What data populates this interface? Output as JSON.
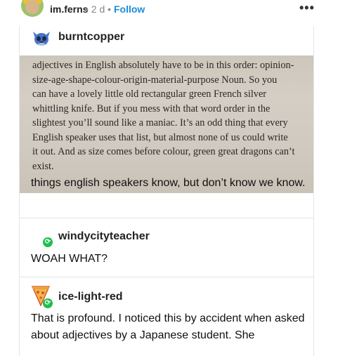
{
  "header": {
    "author": "im.ferns",
    "meta": "• 2 d •",
    "follow_label": "Follow",
    "more_label": "•••"
  },
  "trail": [
    {
      "username": "burntcopper",
      "book_lines": [
        "adjectives in English absolutely have to be in this order: opinion-",
        "size-age-shape-colour-origin-material-purpose Noun. So you",
        "can have a lovely little old rectangular green French silver",
        "whittling knife. But if you mess with that word order in the",
        "slightest you’ll sound like a maniac. It’s an odd thing that every",
        "English speaker uses that list, but almost none of us could write",
        "it out. And as size comes before colour, green great dragons can’t",
        "exist."
      ],
      "body": "things english speakers know, but don’t know we know."
    },
    {
      "username": "windycityteacher",
      "body": "WOAH WHAT?"
    },
    {
      "username": "ice-light-red",
      "body": "That is profound. I noticed this by accident when asked about adjectives by a Japanese student. She"
    }
  ],
  "colors": {
    "follow": "#1a8cd8",
    "reblog_badge": "#1dbf4c"
  },
  "icons": {
    "reblog": "reblog-icon",
    "more": "more-icon"
  }
}
